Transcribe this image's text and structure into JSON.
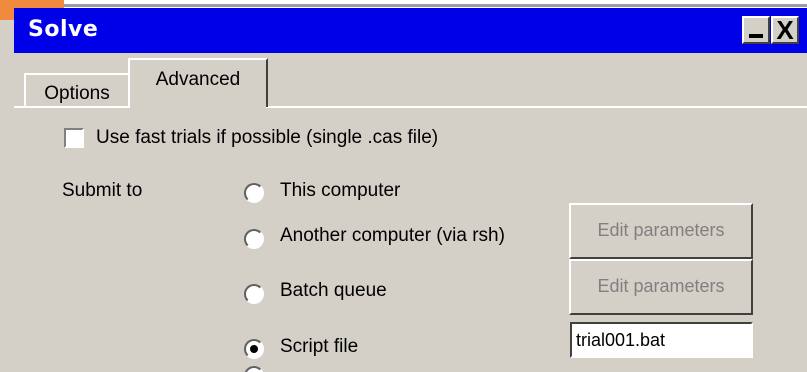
{
  "window": {
    "title": "Solve",
    "minimize_label": "",
    "close_label": "X"
  },
  "tabs": [
    {
      "label": "Options",
      "selected": false
    },
    {
      "label": "Advanced",
      "selected": true
    }
  ],
  "fast_trials": {
    "label": "Use fast trials if possible (single .cas file)",
    "checked": false
  },
  "submit_to": {
    "label": "Submit to",
    "options": [
      {
        "label": "This computer",
        "selected": false
      },
      {
        "label": "Another computer (via rsh)",
        "selected": false,
        "button_label": "Edit parameters",
        "button_enabled": false
      },
      {
        "label": "Batch queue",
        "selected": false,
        "button_label": "Edit parameters",
        "button_enabled": false
      },
      {
        "label": "Script file",
        "selected": true,
        "input_value": "trial001.bat"
      }
    ]
  },
  "colors": {
    "title_bar": "#0000e8",
    "window_face": "#d4d0c8",
    "disabled_text": "#808080"
  }
}
